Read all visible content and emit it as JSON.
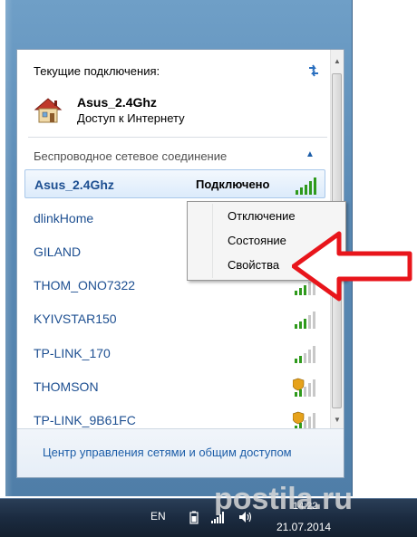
{
  "panel": {
    "header": "Текущие подключения:",
    "current_connection": {
      "name": "Asus_2.4Ghz",
      "status": "Доступ к Интернету"
    },
    "section_label": "Беспроводное сетевое соединение",
    "networks": [
      {
        "name": "Asus_2.4Ghz",
        "state": "Подключено",
        "selected": true,
        "secured": false,
        "signal_bars": 5
      },
      {
        "name": "dlinkHome",
        "state": "",
        "selected": false,
        "secured": false,
        "signal_bars": 0
      },
      {
        "name": "GILAND",
        "state": "",
        "selected": false,
        "secured": false,
        "signal_bars": 0
      },
      {
        "name": "THOM_ONO7322",
        "state": "",
        "selected": false,
        "secured": false,
        "signal_bars": 3
      },
      {
        "name": "KYIVSTAR150",
        "state": "",
        "selected": false,
        "secured": false,
        "signal_bars": 3
      },
      {
        "name": "TP-LINK_170",
        "state": "",
        "selected": false,
        "secured": false,
        "signal_bars": 2
      },
      {
        "name": "THOMSON",
        "state": "",
        "selected": false,
        "secured": true,
        "signal_bars": 2
      },
      {
        "name": "TP-LINK_9B61FC",
        "state": "",
        "selected": false,
        "secured": true,
        "signal_bars": 2
      }
    ],
    "footer_link": "Центр управления сетями и общим доступом"
  },
  "context_menu": {
    "items": [
      "Отключение",
      "Состояние",
      "Свойства"
    ]
  },
  "taskbar": {
    "language": "EN",
    "time": "14:22",
    "date": "21.07.2014"
  },
  "watermark": "postila.ru",
  "colors": {
    "link": "#1d4f91",
    "accent_arrow": "#e8151b",
    "signal_green": "#2f9a1c",
    "taskbar": "#1b2b40"
  },
  "icons": [
    "refresh-icon",
    "house-network-icon",
    "chevron-up-icon",
    "signal-icon",
    "shield-icon",
    "battery-icon",
    "volume-icon",
    "arrow-pointer-icon"
  ]
}
